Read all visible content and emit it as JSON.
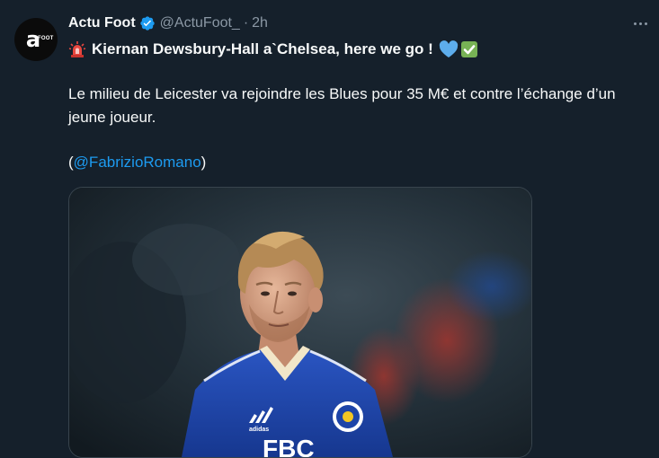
{
  "author": {
    "name": "Actu Foot",
    "handle": "@ActuFoot_",
    "separator": "·",
    "time": "2h",
    "avatar_mark": "a",
    "avatar_text": "FOOT"
  },
  "tweet": {
    "headline": "Kiernan Dewsbury-Hall a`Chelsea, here we go !",
    "paragraph": "Le milieu de Leicester va rejoindre les Blues pour 35 M€ et contre l’échange d’un jeune joueur.",
    "mention_open": "(",
    "mention": "@FabrizioRomano",
    "mention_close": ")"
  },
  "icons": {
    "headline_leading": "rotating-light-icon",
    "headline_trailing": [
      "blue-heart-icon",
      "check-mark-button-icon"
    ],
    "verified": "verified-badge-icon",
    "more": "more-options-icon"
  },
  "colors": {
    "background": "#15202b",
    "text": "#f7f9f9",
    "muted": "#8b98a5",
    "link": "#1d9bf0",
    "verified": "#1d9bf0",
    "jersey": "#1d44a8"
  },
  "media": {
    "jersey_text": "FBC"
  }
}
